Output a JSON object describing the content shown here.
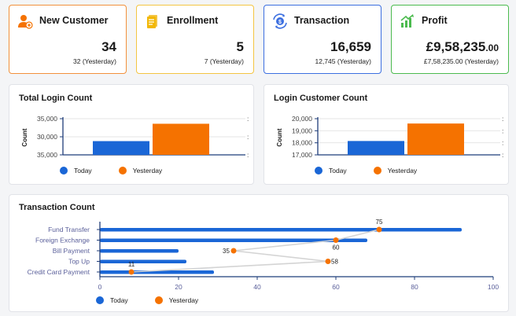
{
  "colors": {
    "today": "#1a66d6",
    "yesterday": "#f57200",
    "orange": "#f2913c",
    "yellow": "#f4c542",
    "blue": "#3c6fe0",
    "green": "#4cbb4f"
  },
  "kpis": [
    {
      "title": "New Customer",
      "value": "34",
      "value_dec": "",
      "sub": "32 (Yesterday)",
      "icon": "user-add-icon"
    },
    {
      "title": "Enrollment",
      "value": "5",
      "value_dec": "",
      "sub": "7 (Yesterday)",
      "icon": "document-icon"
    },
    {
      "title": "Transaction",
      "value": "16,659",
      "value_dec": "",
      "sub": "12,745 (Yesterday)",
      "icon": "exchange-icon"
    },
    {
      "title": "Profit",
      "value": "£9,58,235",
      "value_dec": ".00",
      "sub": "£7,58,235.00 (Yesterday)",
      "icon": "chart-growth-icon"
    }
  ],
  "legend": {
    "today": "Today",
    "yesterday": "Yesterday"
  },
  "chart_data": [
    {
      "type": "bar",
      "title": "Total Login Count",
      "ylabel": "Count",
      "categories": [
        ""
      ],
      "series": [
        {
          "name": "Today",
          "values": [
            28800
          ]
        },
        {
          "name": "Yesterday",
          "values": [
            33600
          ]
        }
      ],
      "ylim": [
        25000,
        35000
      ],
      "yticks": [
        "35,000",
        "30,000",
        "35,000"
      ],
      "legend": "bottom"
    },
    {
      "type": "bar",
      "title": "Login Customer Count",
      "ylabel": "Count",
      "categories": [
        ""
      ],
      "series": [
        {
          "name": "Today",
          "values": [
            18150
          ]
        },
        {
          "name": "Yesterday",
          "values": [
            19600
          ]
        }
      ],
      "ylim": [
        17000,
        20000
      ],
      "yticks": [
        "20,000",
        "19,000",
        "18,000",
        "17,000"
      ],
      "legend": "bottom"
    },
    {
      "type": "bar",
      "orientation": "horizontal",
      "title": "Transaction Count",
      "categories": [
        "Fund Transfer",
        "Foreign Exchange",
        "Bill Payment",
        "Top Up",
        "Credit Card Payment"
      ],
      "series": [
        {
          "name": "Today",
          "values": [
            92,
            68,
            20,
            22,
            29
          ]
        },
        {
          "name": "Yesterday",
          "values": [
            71,
            60,
            34,
            58,
            8
          ]
        }
      ],
      "yesterday_labels": [
        "75",
        "60",
        "35",
        "58",
        "11"
      ],
      "xlim": [
        0,
        100
      ],
      "xticks": [
        "0",
        "20",
        "40",
        "60",
        "80",
        "100"
      ],
      "legend": "bottom"
    }
  ]
}
